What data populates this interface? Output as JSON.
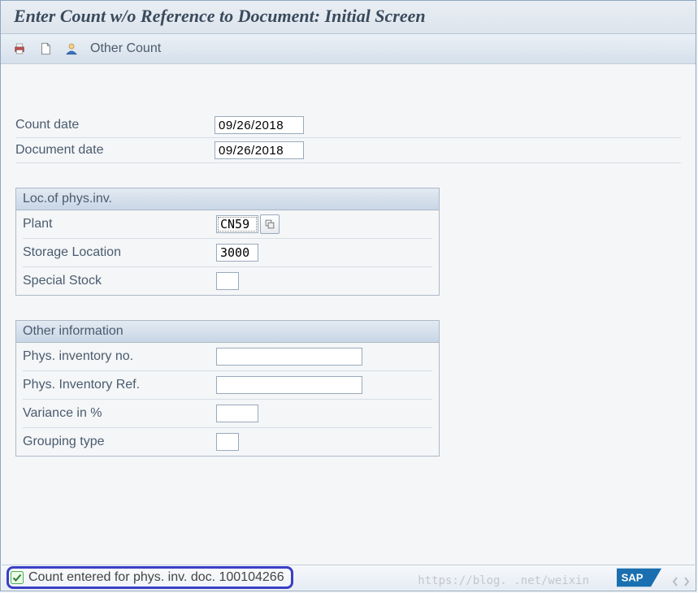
{
  "title": "Enter Count w/o Reference to Document: Initial Screen",
  "toolbar": {
    "other_count": "Other Count",
    "icons": {
      "print": "print-icon",
      "document": "new-document-icon",
      "user": "user-icon"
    }
  },
  "top_fields": {
    "count_date": {
      "label": "Count date",
      "value": "09/26/2018"
    },
    "doc_date": {
      "label": "Document date",
      "value": "09/26/2018"
    }
  },
  "group_loc": {
    "title": "Loc.of phys.inv.",
    "plant": {
      "label": "Plant",
      "value": "CN59"
    },
    "storage": {
      "label": "Storage Location",
      "value": "3000"
    },
    "special": {
      "label": "Special Stock",
      "value": ""
    }
  },
  "group_other": {
    "title": "Other information",
    "phys_no": {
      "label": "Phys. inventory no.",
      "value": ""
    },
    "phys_ref": {
      "label": "Phys. Inventory Ref.",
      "value": ""
    },
    "variance": {
      "label": "Variance in %",
      "value": ""
    },
    "grouping": {
      "label": "Grouping type",
      "value": ""
    }
  },
  "status": {
    "message": "Count entered for phys. inv. doc. 100104266"
  },
  "watermark": "https://blog.      .net/weixin        "
}
